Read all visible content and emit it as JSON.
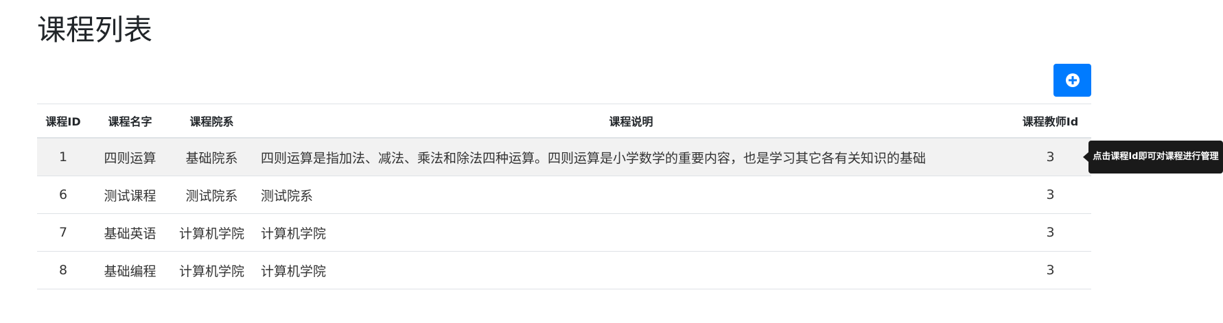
{
  "page": {
    "title": "课程列表"
  },
  "toolbar": {
    "add_icon": "plus-circle-icon",
    "accent_color": "#007bff"
  },
  "table": {
    "headers": [
      "课程ID",
      "课程名字",
      "课程院系",
      "课程说明",
      "课程教师Id"
    ],
    "rows": [
      {
        "id": "1",
        "name": "四则运算",
        "department": "基础院系",
        "description": "四则运算是指加法、减法、乘法和除法四种运算。四则运算是小学数学的重要内容，也是学习其它各有关知识的基础",
        "teacher_id": "3"
      },
      {
        "id": "6",
        "name": "测试课程",
        "department": "测试院系",
        "description": "测试院系",
        "teacher_id": "3"
      },
      {
        "id": "7",
        "name": "基础英语",
        "department": "计算机学院",
        "description": "计算机学院",
        "teacher_id": "3"
      },
      {
        "id": "8",
        "name": "基础编程",
        "department": "计算机学院",
        "description": "计算机学院",
        "teacher_id": "3"
      }
    ]
  },
  "tooltip": {
    "text": "点击课程Id即可对课程进行管理"
  }
}
